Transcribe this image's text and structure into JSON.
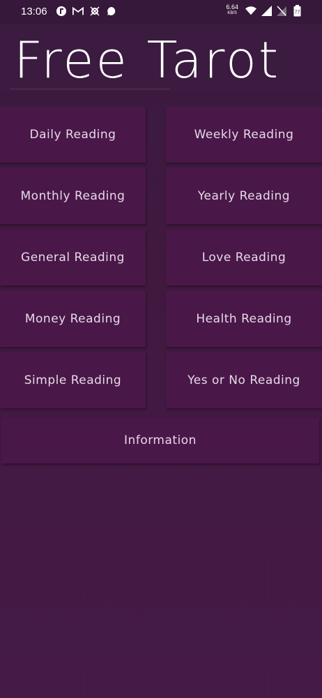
{
  "status_bar": {
    "time": "13:06",
    "left_icons": [
      "tarot-app-notification-icon",
      "gmail-icon",
      "settings-gear-icon",
      "message-bubble-icon"
    ],
    "net_speed_value": "6.64",
    "net_speed_unit": "KB/S",
    "right_icons": [
      "wifi-icon",
      "cellular-signal-icon",
      "no-sim-icon",
      "battery-icon"
    ],
    "battery_level": "77"
  },
  "header": {
    "title": "Free Tarot"
  },
  "menu": {
    "buttons": [
      {
        "label": "Daily Reading"
      },
      {
        "label": "Weekly Reading"
      },
      {
        "label": "Monthly Reading"
      },
      {
        "label": "Yearly Reading"
      },
      {
        "label": "General Reading"
      },
      {
        "label": "Love Reading"
      },
      {
        "label": "Money Reading"
      },
      {
        "label": "Health Reading"
      },
      {
        "label": "Simple Reading"
      },
      {
        "label": "Yes or No Reading"
      }
    ],
    "info_label": "Information"
  },
  "colors": {
    "background": "#42193f",
    "header": "#3b1b40",
    "button": "#4a1749",
    "text": "#e6dbe6"
  }
}
